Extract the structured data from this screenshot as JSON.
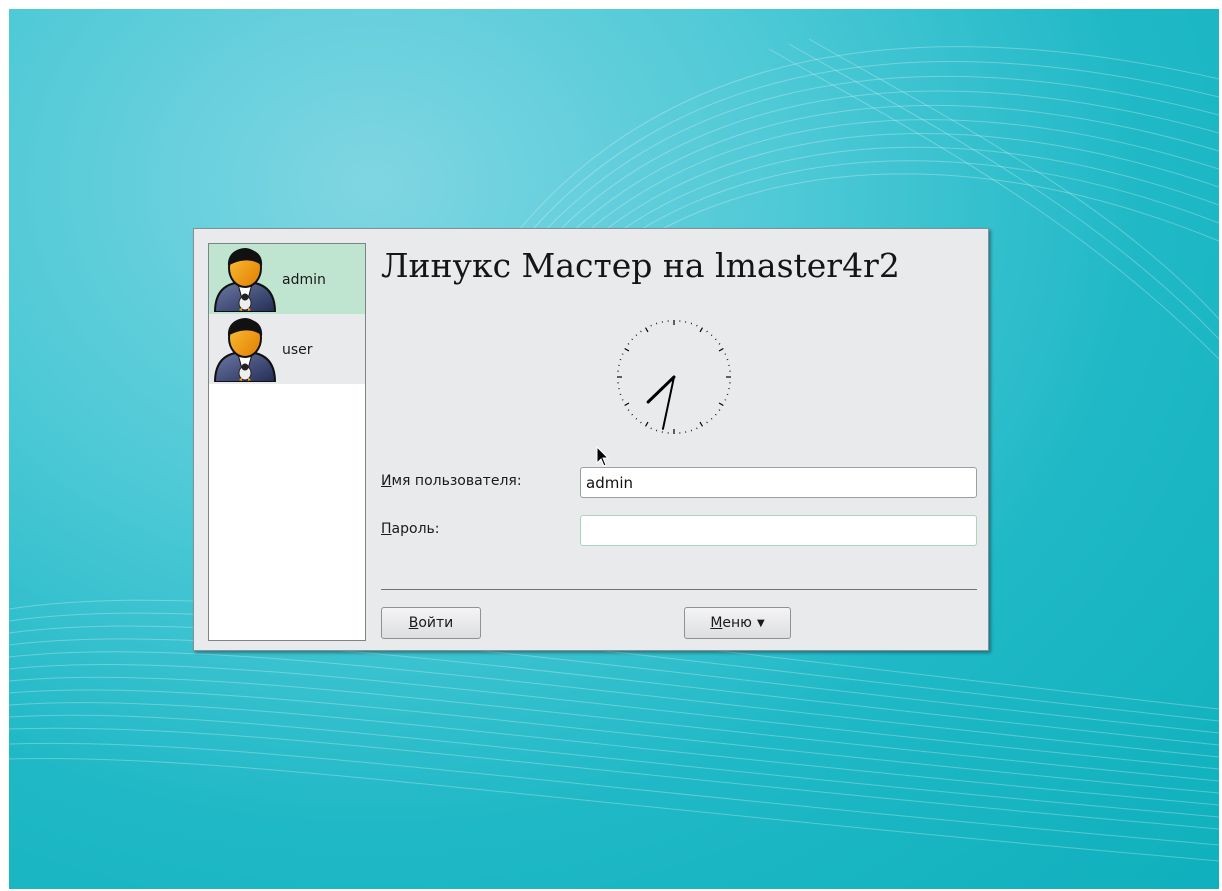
{
  "title": "Линукс Мастер на lmaster4r2",
  "users": [
    {
      "name": "admin",
      "selected": true
    },
    {
      "name": "user",
      "selected": false
    }
  ],
  "clock": {
    "hour": 7,
    "minute": 32
  },
  "form": {
    "username_label_mnemonic": "И",
    "username_label_rest": "мя пользователя:",
    "username_value": "admin",
    "password_label_mnemonic": "П",
    "password_label_rest": "ароль:",
    "password_value": ""
  },
  "buttons": {
    "login_mnemonic": "В",
    "login_rest": "ойти",
    "menu_mnemonic": "М",
    "menu_rest": "еню"
  },
  "icons": {
    "avatar": "user-avatar-icon",
    "menu_arrow": "chevron-down-icon",
    "cursor": "mouse-pointer-icon"
  },
  "colors": {
    "desktop_bg": "#1fb8c6",
    "selected_user_bg": "#bfe4cf",
    "dialog_bg": "#e9eaec"
  }
}
